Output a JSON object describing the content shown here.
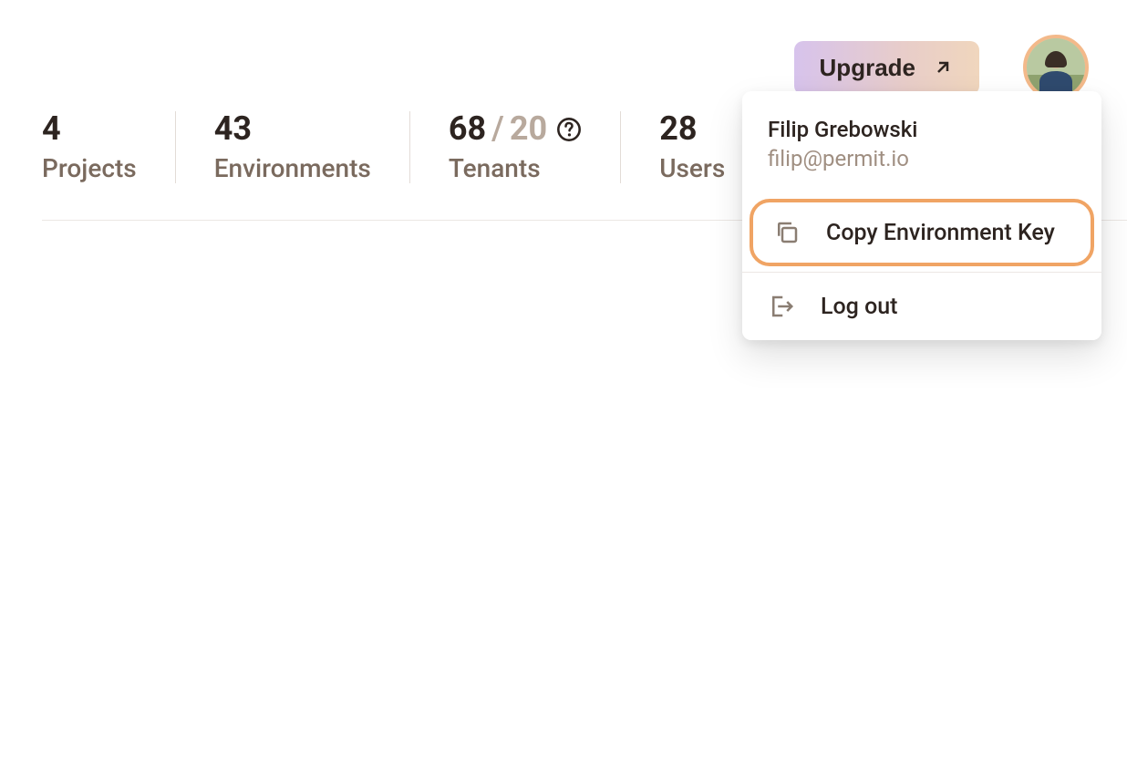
{
  "header": {
    "upgrade_label": "Upgrade"
  },
  "stats": {
    "projects": {
      "value": "4",
      "label": "Projects"
    },
    "environments": {
      "value": "43",
      "label": "Environments"
    },
    "tenants": {
      "value": "68",
      "slash": "/",
      "limit": "20",
      "label": "Tenants"
    },
    "users": {
      "value": "28",
      "label": "Users"
    }
  },
  "user": {
    "name": "Filip Grebowski",
    "email": "filip@permit.io"
  },
  "menu": {
    "copy_env_key": "Copy Environment Key",
    "logout": "Log out"
  }
}
